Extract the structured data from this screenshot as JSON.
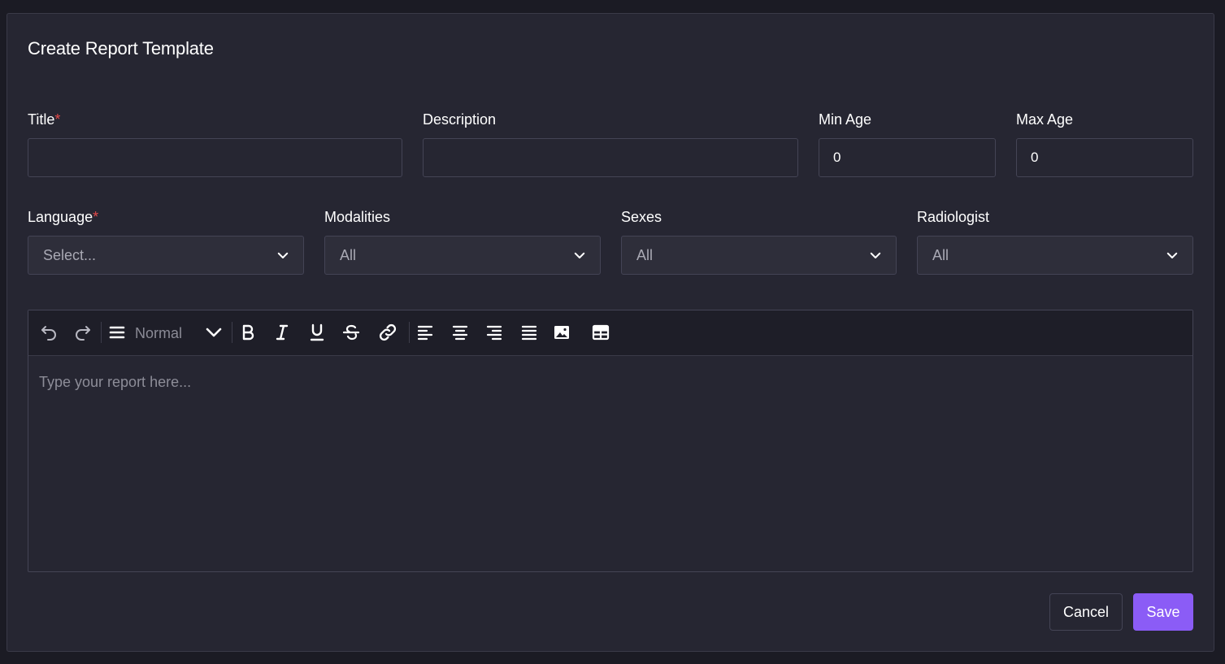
{
  "dialog": {
    "title": "Create Report Template"
  },
  "fields": {
    "title": {
      "label": "Title",
      "required_mark": "*",
      "value": ""
    },
    "description": {
      "label": "Description",
      "value": ""
    },
    "min_age": {
      "label": "Min Age",
      "value": "0"
    },
    "max_age": {
      "label": "Max Age",
      "value": "0"
    },
    "language": {
      "label": "Language",
      "required_mark": "*",
      "value": "Select..."
    },
    "modalities": {
      "label": "Modalities",
      "value": "All"
    },
    "sexes": {
      "label": "Sexes",
      "value": "All"
    },
    "radiologist": {
      "label": "Radiologist",
      "value": "All"
    }
  },
  "editor": {
    "format_select": "Normal",
    "placeholder": "Type your report here...",
    "toolbar_icons": [
      "undo-icon",
      "redo-icon",
      "paragraph-format-icon",
      "chevron-down-icon",
      "bold-icon",
      "italic-icon",
      "underline-icon",
      "strikethrough-icon",
      "link-icon",
      "align-left-icon",
      "align-center-icon",
      "align-right-icon",
      "align-justify-icon",
      "image-icon",
      "table-icon"
    ]
  },
  "actions": {
    "cancel": "Cancel",
    "save": "Save"
  },
  "colors": {
    "page_bg": "#1b1b24",
    "card_bg": "#262632",
    "border": "#444455",
    "required": "#e24a4a",
    "accent": "#8b5cf6"
  }
}
